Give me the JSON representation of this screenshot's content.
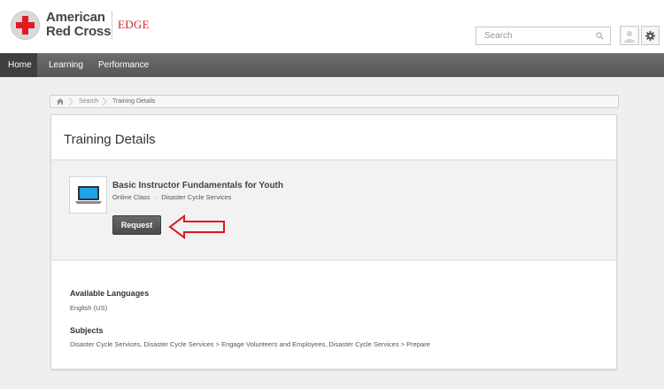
{
  "header": {
    "logo_line1": "American",
    "logo_line2": "Red Cross",
    "logo_edge": "EDGE",
    "search_placeholder": "Search",
    "icons": {
      "search": "search-icon",
      "user": "user-icon",
      "settings": "gear-icon"
    }
  },
  "nav": {
    "items": [
      {
        "label": "Home",
        "active": true
      },
      {
        "label": "Learning",
        "active": false
      },
      {
        "label": "Performance",
        "active": false
      }
    ]
  },
  "breadcrumb": {
    "items": [
      "Search",
      "Training Details"
    ]
  },
  "page": {
    "title": "Training Details"
  },
  "training": {
    "title": "Basic Instructor Fundamentals for Youth",
    "type": "Online Class",
    "separator": "·",
    "provider": "Disaster Cycle Services",
    "request_label": "Request"
  },
  "details": {
    "languages_heading": "Available Languages",
    "languages_value": "English (US)",
    "subjects_heading": "Subjects",
    "subjects_value": "Disaster Cycle Services, Disaster Cycle Services > Engage Volunteers and Employees, Disaster Cycle Services > Prepare"
  },
  "colors": {
    "brand_red": "#e21b23",
    "nav_bg": "#5f5f5f",
    "nav_active": "#3f3f3f",
    "arrow_red": "#e0141b",
    "request_button": "#555555"
  }
}
